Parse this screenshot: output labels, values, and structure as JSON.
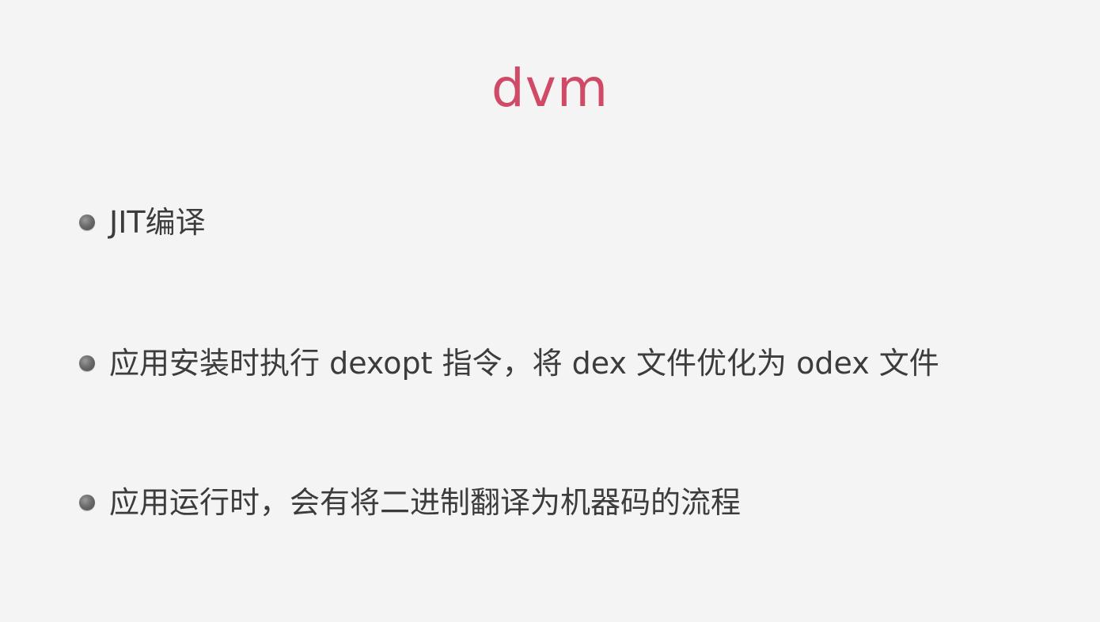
{
  "slide": {
    "title": "dvm",
    "bullets": [
      {
        "text": "JIT编译"
      },
      {
        "text": "应用安装时执行 dexopt 指令，将 dex 文件优化为 odex 文件"
      },
      {
        "text": "应用运行时，会有将二进制翻译为机器码的流程"
      }
    ]
  },
  "colors": {
    "background": "#f4f4f4",
    "title": "#d04a68",
    "body_text": "#3c3c3c",
    "bullet": "#6c6c6c"
  }
}
